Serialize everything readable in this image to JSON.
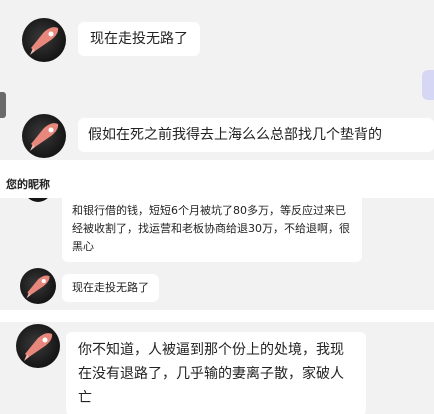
{
  "colors": {
    "chat_background": "#f2f2f2",
    "bubble_background": "#ffffff",
    "section_divider": "#ffffff",
    "header_background": "#ffffff",
    "avatar_dark": "#151515",
    "avatar_rocket": "#e8877c"
  },
  "panel_1": {
    "messages": [
      {
        "sender_icon": "rocket-avatar-icon",
        "text": "现在走投无路了"
      },
      {
        "sender_icon": "rocket-avatar-icon",
        "text": "假如在死之前我得去上海么么总部找几个垫背的"
      }
    ]
  },
  "panel_2": {
    "header_title": "您的昵称",
    "messages": [
      {
        "text": "和银行借的钱，短短6个月被坑了80多万，等反应过来已经被收割了，找运营和老板协商给退30万，不给退啊，很黑心"
      },
      {
        "sender_icon": "rocket-avatar-icon",
        "text": "现在走投无路了"
      }
    ]
  },
  "panel_3": {
    "messages": [
      {
        "sender_icon": "rocket-avatar-icon",
        "text": "你不知道，人被逼到那个份上的处境，我现在没有退路了，几乎输的妻离子散，家破人亡"
      }
    ]
  }
}
